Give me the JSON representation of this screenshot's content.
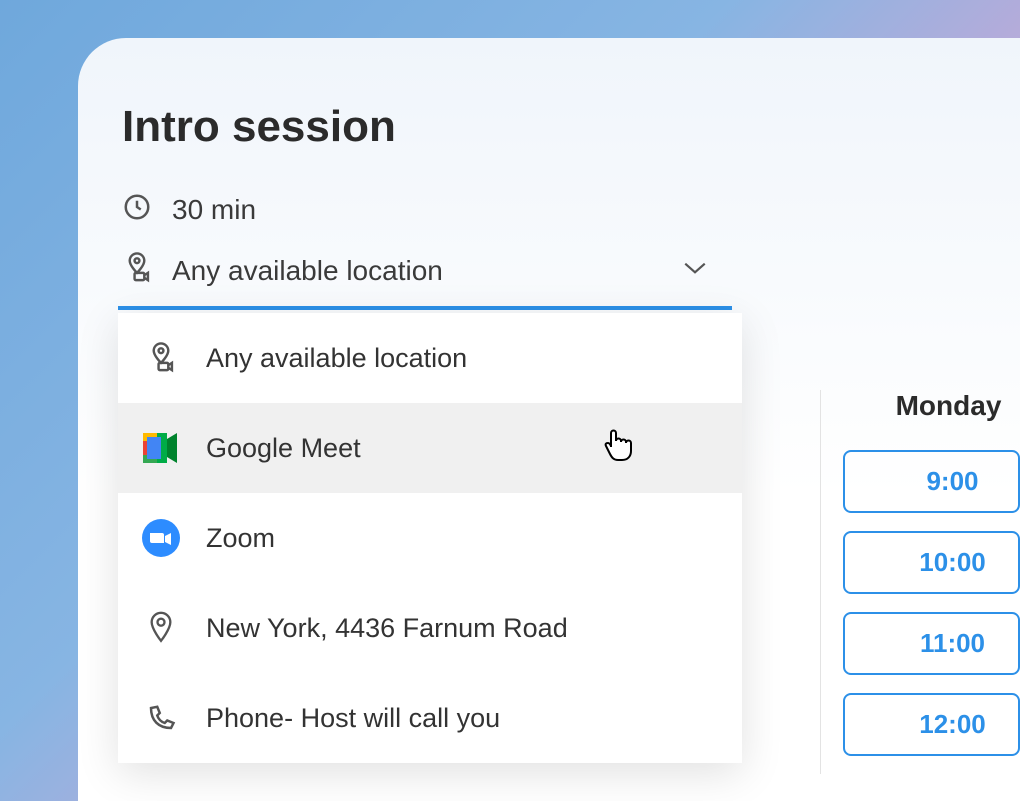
{
  "title": "Intro session",
  "duration": {
    "text": "30 min"
  },
  "location_selected": "Any available location",
  "dropdown": [
    {
      "label": "Any available location",
      "icon": "location-camera-icon"
    },
    {
      "label": "Google Meet",
      "icon": "google-meet-icon"
    },
    {
      "label": "Zoom",
      "icon": "zoom-icon"
    },
    {
      "label": "New York, 4436 Farnum Road",
      "icon": "pin-icon"
    },
    {
      "label": "Phone- Host will call you",
      "icon": "phone-icon"
    }
  ],
  "day": "Monday",
  "timeslots": [
    "9:00",
    "10:00",
    "11:00",
    "12:00"
  ]
}
